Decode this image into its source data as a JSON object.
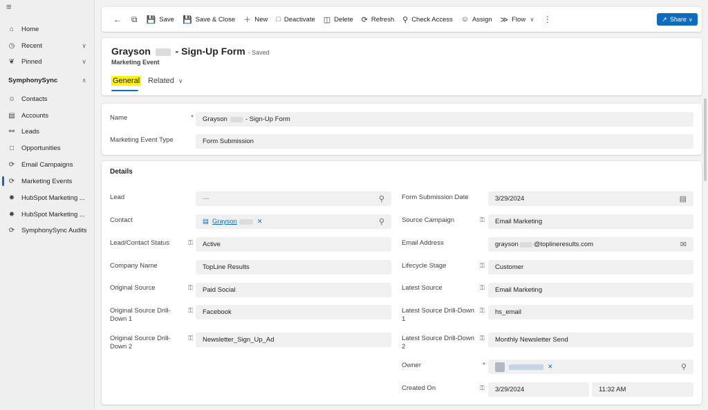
{
  "sidebar": {
    "home": "Home",
    "recent": "Recent",
    "pinned": "Pinned",
    "section": "SymphonySync",
    "items": [
      {
        "label": "Contacts",
        "icon": "person-icon"
      },
      {
        "label": "Accounts",
        "icon": "building-icon"
      },
      {
        "label": "Leads",
        "icon": "leads-icon"
      },
      {
        "label": "Opportunities",
        "icon": "opportunity-icon"
      },
      {
        "label": "Email Campaigns",
        "icon": "campaign-icon"
      },
      {
        "label": "Marketing Events",
        "icon": "event-icon"
      },
      {
        "label": "HubSpot Marketing ...",
        "icon": "hubspot-icon"
      },
      {
        "label": "HubSpot Marketing ...",
        "icon": "hubspot-icon"
      },
      {
        "label": "SymphonySync Audits",
        "icon": "audit-icon"
      }
    ]
  },
  "toolbar": {
    "save": "Save",
    "save_close": "Save & Close",
    "new": "New",
    "deactivate": "Deactivate",
    "delete": "Delete",
    "refresh": "Refresh",
    "check_access": "Check Access",
    "assign": "Assign",
    "flow": "Flow",
    "share": "Share"
  },
  "header": {
    "title_first": "Grayson",
    "title_rest": "- Sign-Up Form",
    "saved": "- Saved",
    "entity": "Marketing Event",
    "tab_general": "General",
    "tab_related": "Related"
  },
  "general": {
    "name_label": "Name",
    "name_first": "Grayson",
    "name_rest": "- Sign-Up Form",
    "type_label": "Marketing Event Type",
    "type_value": "Form Submission"
  },
  "details": {
    "title": "Details",
    "left": [
      {
        "label": "Lead",
        "value": "---"
      },
      {
        "label": "Contact",
        "value": "Grayson"
      },
      {
        "label": "Lead/Contact Status",
        "value": "Active"
      },
      {
        "label": "Company Name",
        "value": "TopLine Results"
      },
      {
        "label": "Original Source",
        "value": "Paid Social"
      },
      {
        "label": "Original Source Drill-Down 1",
        "value": "Facebook"
      },
      {
        "label": "Original Source Drill-Down 2",
        "value": "Newsletter_Sign_Up_Ad"
      }
    ],
    "right": [
      {
        "label": "Form Submission Date",
        "value": "3/29/2024"
      },
      {
        "label": "Source Campaign",
        "value": "Email Marketing"
      },
      {
        "label": "Email Address",
        "value_first": "grayson",
        "value_rest": "@toplineresults.com"
      },
      {
        "label": "Lifecycle Stage",
        "value": "Customer"
      },
      {
        "label": "Latest Source",
        "value": "Email Marketing"
      },
      {
        "label": "Latest Source Drill-Down 1",
        "value": "hs_email"
      },
      {
        "label": "Latest Source Drill-Down 2",
        "value": "Monthly Newsletter Send"
      },
      {
        "label": "Owner",
        "value": ""
      },
      {
        "label": "Created On",
        "date": "3/29/2024",
        "time": "11:32 AM"
      }
    ]
  }
}
